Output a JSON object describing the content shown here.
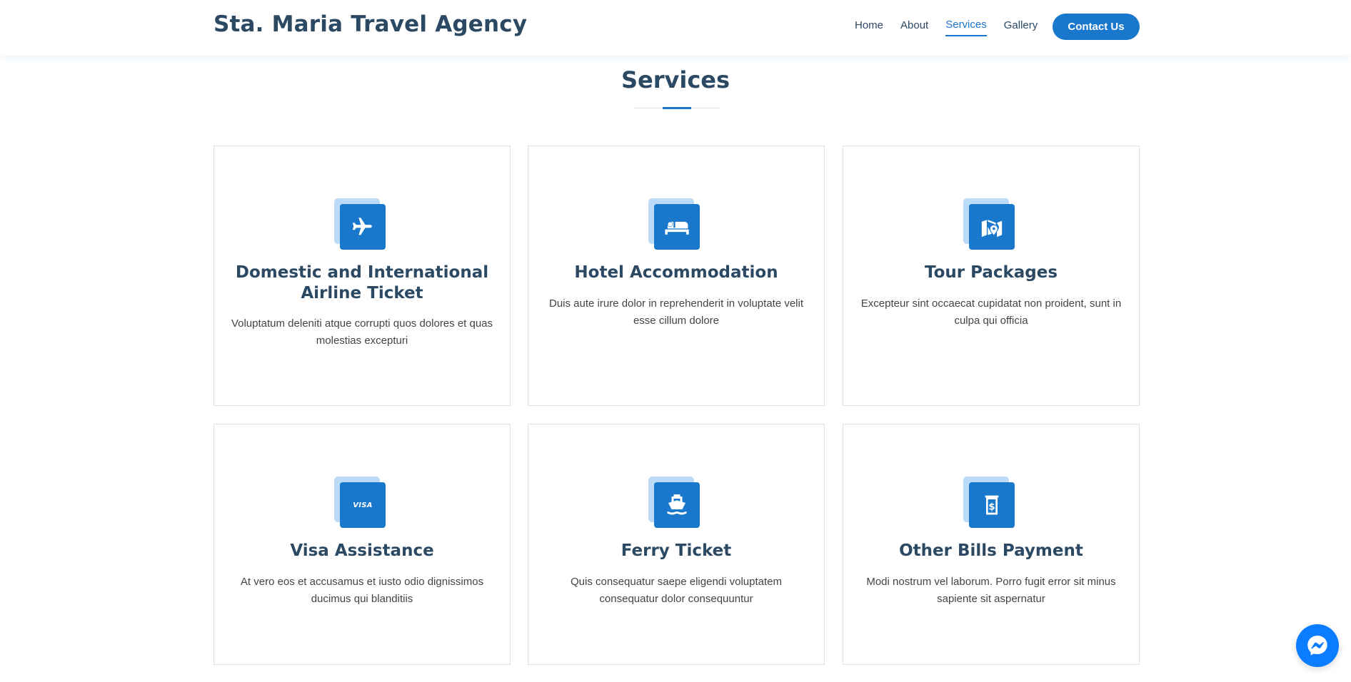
{
  "header": {
    "logo": "Sta. Maria Travel Agency",
    "nav": [
      {
        "label": "Home",
        "active": false
      },
      {
        "label": "About",
        "active": false
      },
      {
        "label": "Services",
        "active": true
      },
      {
        "label": "Gallery",
        "active": false
      }
    ],
    "contact_button": "Contact Us"
  },
  "section": {
    "title": "Services"
  },
  "services": [
    {
      "icon": "airplane-icon",
      "title": "Domestic and International Airline Ticket",
      "description": "Voluptatum deleniti atque corrupti quos dolores et quas molestias excepturi"
    },
    {
      "icon": "bed-icon",
      "title": "Hotel Accommodation",
      "description": "Duis aute irure dolor in reprehenderit in voluptate velit esse cillum dolore"
    },
    {
      "icon": "map-location-icon",
      "title": "Tour Packages",
      "description": "Excepteur sint occaecat cupidatat non proident, sunt in culpa qui officia"
    },
    {
      "icon": "visa-card-icon",
      "title": "Visa Assistance",
      "description": "At vero eos et accusamus et iusto odio dignissimos ducimus qui blanditiis"
    },
    {
      "icon": "ship-icon",
      "title": "Ferry Ticket",
      "description": "Quis consequatur saepe eligendi voluptatem consequatur dolor consequuntur"
    },
    {
      "icon": "money-bill-icon",
      "title": "Other Bills Payment",
      "description": "Modi nostrum vel laborum. Porro fugit error sit minus sapiente sit aspernatur"
    }
  ],
  "visa_icon_text": "VISA",
  "colors": {
    "accent": "#1977cc",
    "accent_light": "#badaf7",
    "heading": "#2c4964",
    "messenger": "#0a7cff"
  }
}
